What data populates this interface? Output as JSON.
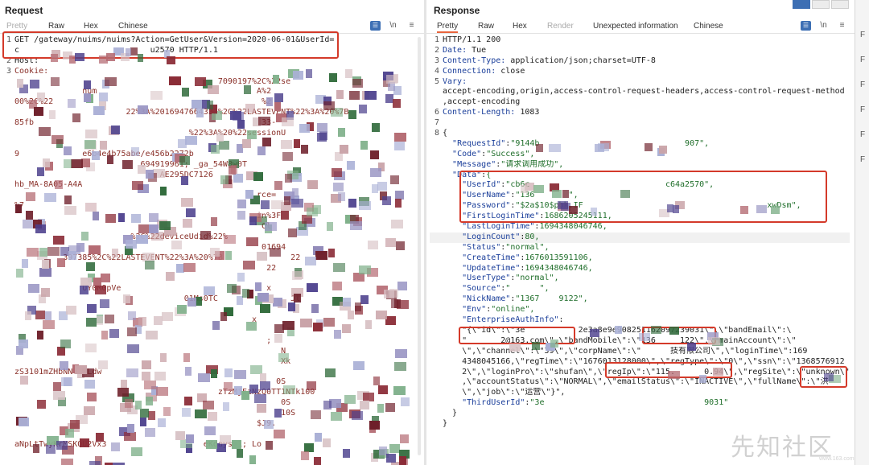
{
  "request": {
    "title": "Request",
    "tabs": [
      "Pretty",
      "Raw",
      "Hex",
      "Chinese"
    ],
    "active_tab": "Raw",
    "wrap_label": "\\n",
    "lines": [
      {
        "num": "1",
        "text": "GET /gateway/nuims/nuims?Action=GetUser&Version=2020-06-01&UserId="
      },
      {
        "num": "",
        "text": "c                           u2570 HTTP/1.1"
      },
      {
        "num": "2",
        "text": "Host: "
      },
      {
        "num": "3",
        "text": "Cookie:"
      },
      {
        "num": "",
        "text": "                                          7090197%2C%22se"
      },
      {
        "num": "",
        "text": "              num                                 A%2"
      },
      {
        "num": "",
        "text": "00%2C%22                                           %2"
      },
      {
        "num": "",
        "text": "                       22%3A%2016947664332%2C%22LASTEVENT%22%3A%20%7B"
      },
      {
        "num": "",
        "text": "85fb                                               33-"
      },
      {
        "num": "",
        "text": "                                    %22%3A%20%22sessionU"
      },
      {
        "num": "",
        "text": "                                                        "
      },
      {
        "num": "",
        "text": "9             e6b4e4b75abe/e456b2272b                   "
      },
      {
        "num": "",
        "text": "                          694919961; _ga_54W8w0T"
      },
      {
        "num": "",
        "text": "                              AE295DC7126"
      },
      {
        "num": "",
        "text": "hb_MA-8A05-A4A             "
      },
      {
        "num": "",
        "text": "                                                  rce="
      },
      {
        "num": "",
        "text": "%7                                              "
      },
      {
        "num": "",
        "text": "                                                  in%3F"
      },
      {
        "num": "",
        "text": "                                                   Cl"
      },
      {
        "num": "",
        "text": "                        %2C%22deviceUdid%22%"
      },
      {
        "num": "",
        "text": "                                                   01694"
      },
      {
        "num": "",
        "text": "          397385%2C%22LASTEVENT%22%3A%20%7B              22"
      },
      {
        "num": "",
        "text": "                                                    22"
      },
      {
        "num": "",
        "text": "                                                   "
      },
      {
        "num": "",
        "text": "              UY0M0pVe                              x"
      },
      {
        "num": "",
        "text": "                                   01Ms0TC               Jl"
      },
      {
        "num": "",
        "text": "                                                       "
      },
      {
        "num": "",
        "text": "                                                 x"
      },
      {
        "num": "",
        "text": "                                                      "
      },
      {
        "num": "",
        "text": "                                                    ;"
      },
      {
        "num": "",
        "text": "                                                       N"
      },
      {
        "num": "",
        "text": "                                                       Xk"
      },
      {
        "num": "",
        "text": "zS3101mZHbNNttwLdw                                       "
      },
      {
        "num": "",
        "text": "                                                      0S"
      },
      {
        "num": "",
        "text": "                                          zTzMjEzNzQ0TT1NTk100"
      },
      {
        "num": "",
        "text": "                                                       0S"
      },
      {
        "num": "",
        "text": "                                                       10S"
      },
      {
        "num": "",
        "text": "                                                  $J9."
      },
      {
        "num": "",
        "text": "                                                    "
      },
      {
        "num": "",
        "text": "aNpLtTwyKrMSKQU2Vx3                    eKdays=1; Lo"
      }
    ]
  },
  "response": {
    "title": "Response",
    "tabs": [
      "Pretty",
      "Raw",
      "Hex",
      "Render",
      "Unexpected information",
      "Chinese"
    ],
    "active_tab": "Pretty",
    "disabled_tab": "Render",
    "wrap_label": "\\n",
    "lines": [
      {
        "num": "1",
        "text": "HTTP/1.1 200"
      },
      {
        "num": "2",
        "text": "Date: Tue"
      },
      {
        "num": "3",
        "text": "Content-Type: application/json;charset=UTF-8"
      },
      {
        "num": "4",
        "text": "Connection: close"
      },
      {
        "num": "5",
        "text": "Vary:"
      },
      {
        "num": "",
        "text": "accept-encoding,origin,access-control-request-headers,access-control-request-method"
      },
      {
        "num": "",
        "text": ",accept-encoding"
      },
      {
        "num": "6",
        "text": "Content-Length: 1083"
      },
      {
        "num": "7",
        "text": ""
      },
      {
        "num": "8",
        "text": "{"
      },
      {
        "num": "",
        "text": "  \"RequestId\":\"9144b                              907\","
      },
      {
        "num": "",
        "text": "  \"Code\":\"Success\","
      },
      {
        "num": "",
        "text": "  \"Message\":\"请求调用成功\","
      },
      {
        "num": "",
        "text": "  \"Data\":{"
      },
      {
        "num": "",
        "text": "    \"UserId\":\"cb6c                            c64a2570\","
      },
      {
        "num": "",
        "text": "    \"UserName\":\"136       \","
      },
      {
        "num": "",
        "text": "    \"Password\":\"$2a$10$pbk.IF                                      xwDsm\","
      },
      {
        "num": "",
        "text": "    \"FirstLoginTime\":1686205245111,"
      },
      {
        "num": "",
        "text": "    \"LastLoginTime\":1694348046746,"
      },
      {
        "num": "",
        "text": "    \"LoginCount\":80,"
      },
      {
        "num": "",
        "text": "    \"Status\":\"normal\","
      },
      {
        "num": "",
        "text": "    \"CreateTime\":1676013591106,"
      },
      {
        "num": "",
        "text": "    \"UpdateTime\":1694348046746,"
      },
      {
        "num": "",
        "text": "    \"UserType\":\"normal\","
      },
      {
        "num": "",
        "text": "    \"Source\":\"      \","
      },
      {
        "num": "",
        "text": "    \"NickName\":\"1367    9122\","
      },
      {
        "num": "",
        "text": "    \"Env\":\"online\","
      },
      {
        "num": "",
        "text": "    \"EnterpriseAuthInfo\":"
      },
      {
        "num": "",
        "text": "    \"{\\\"id\\\":\\\"3e           2e3a8e9e908251162097239031\\\",\\\"bandEmail\\\":\\"
      },
      {
        "num": "",
        "text": "    \"       2@163.com\\\",\\\"bandMobile\\\":\\\"136     122\\\",\\\"mainAccount\\\":\\\"     "
      },
      {
        "num": "",
        "text": "    \\\",\\\"channel\\\":\\\"39\\\",\\\"corpName\\\":\\\"      技有限公司\\\",\\\"loginTime\\\":169"
      },
      {
        "num": "",
        "text": "    4348045166,\\\"regTime\\\":\\\"1676013128000\\\",\\\"regType\\\":\\\"0\\\",\\\"ssn\\\":\\\"1368576912"
      },
      {
        "num": "",
        "text": "    2\\\",\\\"loginPro\\\":\\\"shufan\\\",\\\"regIp\\\":\\\"115.      0.94\\\",\\\"regSite\\\":\\\"unknown\\\""
      },
      {
        "num": "",
        "text": "    ,\\\"accountStatus\\\":\\\"NORMAL\\\",\\\"emailStatus\\\":\\\"INACTIVE\\\",\\\"fullName\\\":\\\"洪   "
      },
      {
        "num": "",
        "text": "    \\\",\\\"job\\\":\\\"运营\\\"}\","
      },
      {
        "num": "",
        "text": "    \"ThirdUserId\":\"3e                                 9031\""
      },
      {
        "num": "",
        "text": "  }"
      },
      {
        "num": "",
        "text": "}"
      }
    ]
  },
  "right_strip": [
    "F",
    "F",
    "F",
    "F",
    "F",
    "F"
  ],
  "watermark": {
    "text": "先知社区",
    "sub": "www.163.com"
  },
  "colors": {
    "accent_tab": "#e8643c",
    "annotation": "#d43a2a",
    "wrap_button": "#3d6fb4"
  }
}
